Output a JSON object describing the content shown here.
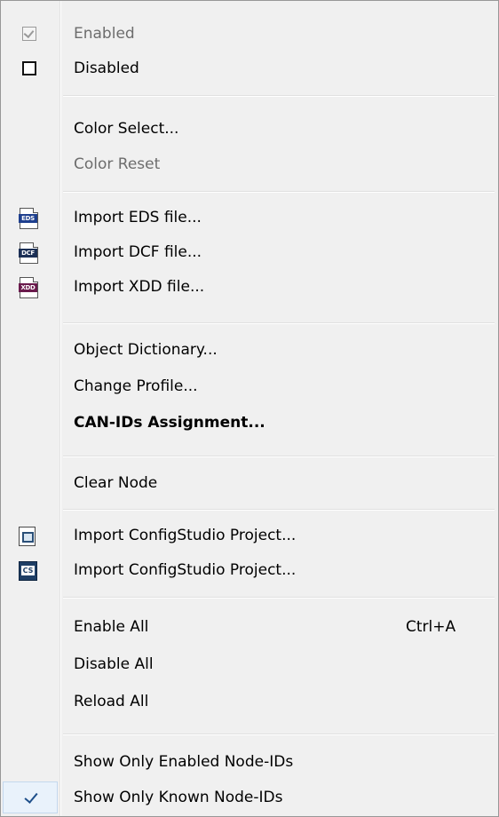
{
  "menu": {
    "items": [
      {
        "label": "Enabled",
        "disabled": true,
        "icon": "checkbox-checked-gray-icon"
      },
      {
        "label": "Disabled",
        "icon": "checkbox-empty-icon"
      },
      {
        "label": "Color Select..."
      },
      {
        "label": "Color Reset",
        "disabled": true
      },
      {
        "label": "Import EDS file...",
        "icon": "eds-file-icon",
        "icon_text": "EDS",
        "icon_color": "#1e3f8e"
      },
      {
        "label": "Import DCF file...",
        "icon": "dcf-file-icon",
        "icon_text": "DCF",
        "icon_color": "#1b2f55"
      },
      {
        "label": "Import XDD file...",
        "icon": "xdd-file-icon",
        "icon_text": "XDD",
        "icon_color": "#6a1a4c"
      },
      {
        "label": "Object Dictionary..."
      },
      {
        "label": "Change Profile..."
      },
      {
        "label": "CAN-IDs Assignment...",
        "bold": true
      },
      {
        "label": "Clear Node"
      },
      {
        "label": "Import ConfigStudio Project...",
        "icon": "configstudio-project-icon"
      },
      {
        "label": "Import ConfigStudio Project...",
        "icon": "cs-project-icon",
        "icon_text": "CS"
      },
      {
        "label": "Enable All",
        "shortcut": "Ctrl+A"
      },
      {
        "label": "Disable All"
      },
      {
        "label": "Reload All"
      },
      {
        "label": "Show Only Enabled Node-IDs"
      },
      {
        "label": "Show Only Known Node-IDs",
        "checked": true,
        "icon": "checkmark-icon"
      }
    ]
  }
}
